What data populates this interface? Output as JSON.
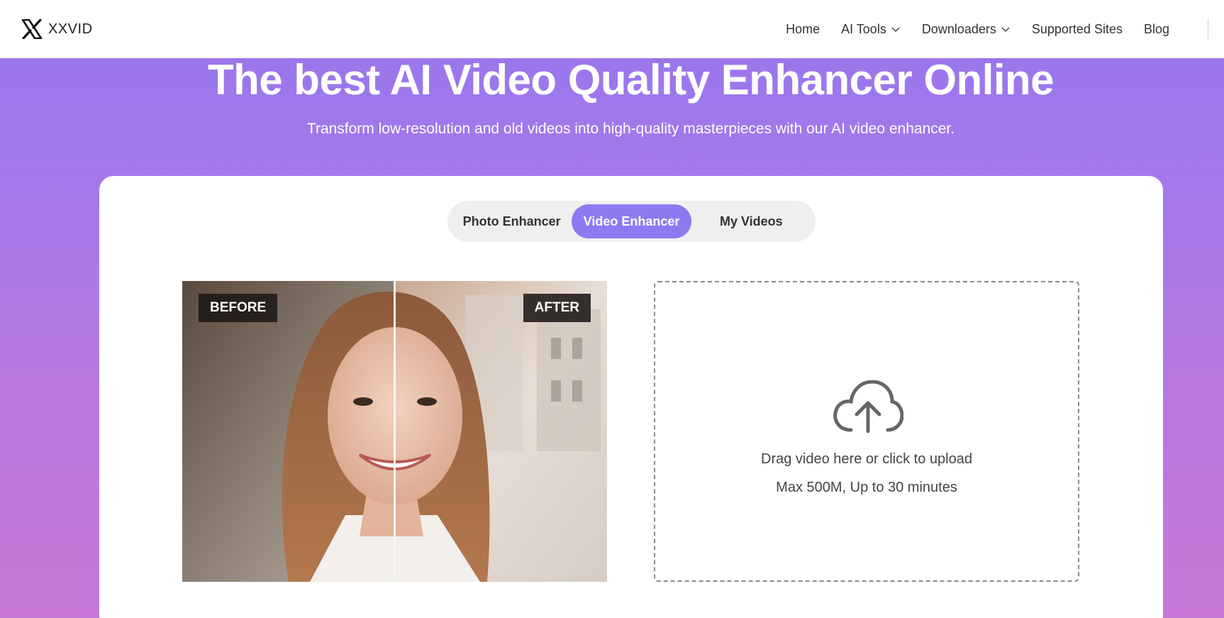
{
  "brand": {
    "name": "XXVID",
    "logo_icon": "x-logo-icon"
  },
  "nav": {
    "items": [
      {
        "label": "Home",
        "has_dropdown": false
      },
      {
        "label": "AI Tools",
        "has_dropdown": true
      },
      {
        "label": "Downloaders",
        "has_dropdown": true
      },
      {
        "label": "Supported Sites",
        "has_dropdown": false
      },
      {
        "label": "Blog",
        "has_dropdown": false
      }
    ]
  },
  "hero": {
    "title": "The best AI Video Quality Enhancer Online",
    "subtitle": "Transform low-resolution and old videos into high-quality masterpieces with our AI video enhancer."
  },
  "tabs": {
    "items": [
      "Photo Enhancer",
      "Video Enhancer",
      "My Videos"
    ],
    "active": "Video Enhancer"
  },
  "comparison": {
    "before_label": "BEFORE",
    "after_label": "AFTER"
  },
  "upload": {
    "icon": "cloud-upload-icon",
    "instruction": "Drag video here or click to upload",
    "limits": "Max 500M, Up to 30 minutes"
  },
  "colors": {
    "accent": "#8f79f0",
    "gradient_top": "#9776ee",
    "gradient_bottom": "#c677d6"
  }
}
